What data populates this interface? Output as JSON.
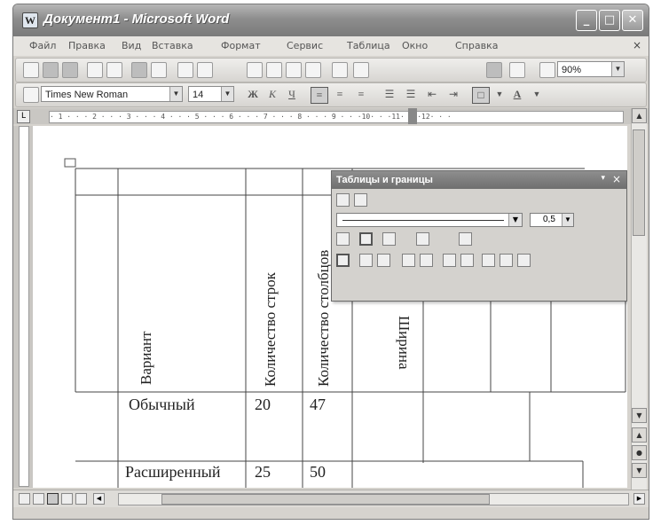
{
  "window": {
    "title": "Документ1 - Microsoft Word",
    "app_icon": "W"
  },
  "window_buttons": {
    "minimize": "_",
    "maximize": "□",
    "close": "✕"
  },
  "menubar": {
    "items": [
      "Файл",
      "Правка",
      "Вид",
      "Вставка",
      "Формат",
      "Сервис",
      "Таблица",
      "Окно",
      "Справка"
    ],
    "close_glyph": "×"
  },
  "standard_toolbar": {
    "zoom": "90%"
  },
  "formatting_toolbar": {
    "font_name": "Times New Roman",
    "font_size": "14",
    "bold": "Ж",
    "italic": "К",
    "underline": "Ч"
  },
  "ruler": {
    "tab_selector": "L",
    "marks": "· 1 · · · 2 · · · 3 · · · 4 · · · 5 · · · 6 · · · 7 · · · 8 · · · 9 · · ·10· · ·11· · ·12· · ·"
  },
  "document": {
    "table": {
      "headers": [
        "Вариант",
        "Количество строк",
        "Количество столбцов",
        "Ширина"
      ],
      "rows": [
        {
          "variant": "Обычный",
          "rows_count": "20",
          "cols_count": "47"
        },
        {
          "variant": "Расширенный",
          "rows_count": "25",
          "cols_count": "50"
        }
      ]
    }
  },
  "tables_and_borders_toolbar": {
    "title": "Таблицы и границы",
    "line_weight": "0,5",
    "close_glyph": "×",
    "dropdown_glyph": "▾"
  }
}
